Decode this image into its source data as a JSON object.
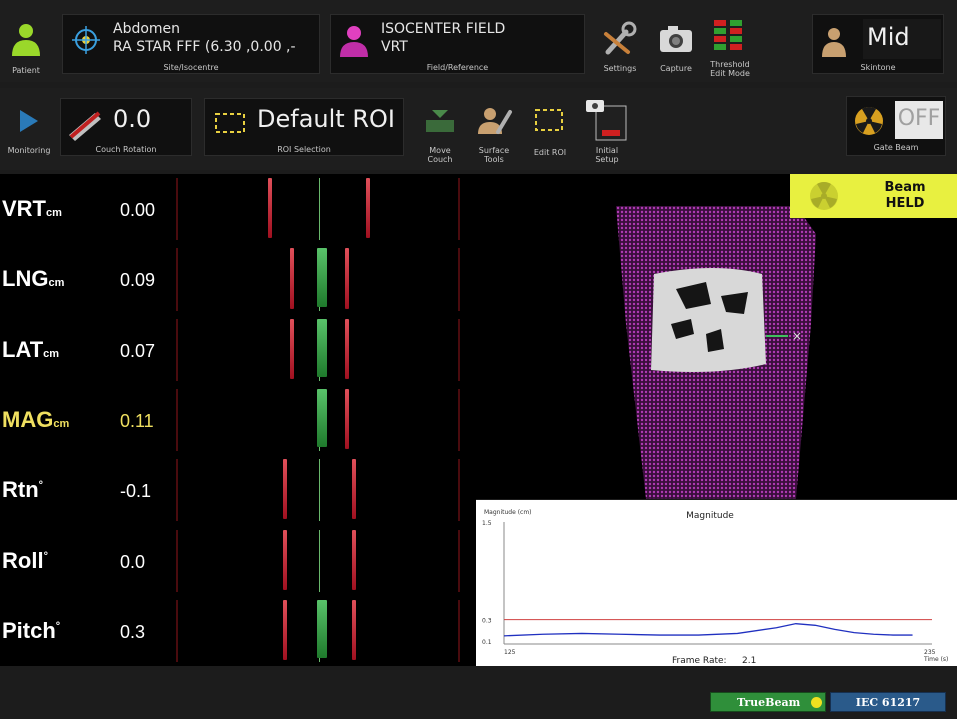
{
  "top": {
    "patient": {
      "label": "Patient"
    },
    "site": {
      "name": "Abdomen",
      "iso": "RA STAR FFF  (6.30 ,0.00 ,-",
      "caption": "Site/Isocentre"
    },
    "field": {
      "name": "ISOCENTER FIELD",
      "ref": "VRT",
      "caption": "Field/Reference"
    },
    "settings": "Settings",
    "capture": "Capture",
    "threshold": [
      "Threshold",
      "Edit Mode"
    ],
    "skintone": {
      "value": "Mid",
      "caption": "Skintone"
    }
  },
  "second": {
    "monitoring": "Monitoring",
    "couch": {
      "value": "0.0",
      "caption": "Couch Rotation"
    },
    "roi": {
      "value": "Default ROI",
      "caption": "ROI Selection"
    },
    "move_couch": [
      "Move",
      "Couch"
    ],
    "surface_tools": [
      "Surface",
      "Tools"
    ],
    "edit_roi": "Edit ROI",
    "initial_setup": [
      "Initial",
      "Setup"
    ],
    "gate": {
      "value": "OFF",
      "caption": "Gate Beam"
    }
  },
  "metrics": [
    {
      "name": "VRT",
      "unit": "cm",
      "value": "0.00",
      "highlight": false
    },
    {
      "name": "LNG",
      "unit": "cm",
      "value": "0.09",
      "highlight": false
    },
    {
      "name": "LAT",
      "unit": "cm",
      "value": "0.07",
      "highlight": false
    },
    {
      "name": "MAG",
      "unit": "cm",
      "value": "0.11",
      "highlight": true
    },
    {
      "name": "Rtn",
      "unit": "°",
      "value": "-0.1",
      "highlight": false
    },
    {
      "name": "Roll",
      "unit": "°",
      "value": "0.0",
      "highlight": false
    },
    {
      "name": "Pitch",
      "unit": "°",
      "value": "0.3",
      "highlight": false
    }
  ],
  "beam": {
    "line1": "Beam",
    "line2": "HELD"
  },
  "chart_data": {
    "type": "line",
    "title": "Magnitude",
    "ylabel": "Magnitude (cm)",
    "xlabel": "Time (s)",
    "x_ticks": [
      "125",
      "235"
    ],
    "y_ticks": [
      "1.5",
      "0.3",
      "0.1"
    ],
    "xlim": [
      125,
      235
    ],
    "ylim": [
      0,
      1.5
    ],
    "threshold": 0.3,
    "series": [
      {
        "x": [
          125,
          135,
          145,
          155,
          165,
          175,
          185,
          195,
          200,
          205,
          210,
          215,
          220,
          225,
          230
        ],
        "y": [
          0.1,
          0.12,
          0.13,
          0.12,
          0.11,
          0.11,
          0.13,
          0.2,
          0.25,
          0.23,
          0.18,
          0.14,
          0.12,
          0.11,
          0.11
        ]
      }
    ],
    "frame_rate_label": "Frame Rate:",
    "frame_rate_value": "2.1"
  },
  "status": {
    "truebeam": "TrueBeam",
    "iec": "IEC 61217"
  },
  "colors": {
    "green": "#2f8f3a",
    "red": "#c0202a",
    "yellow": "#e8f040",
    "iec": "#2a5a8a"
  }
}
